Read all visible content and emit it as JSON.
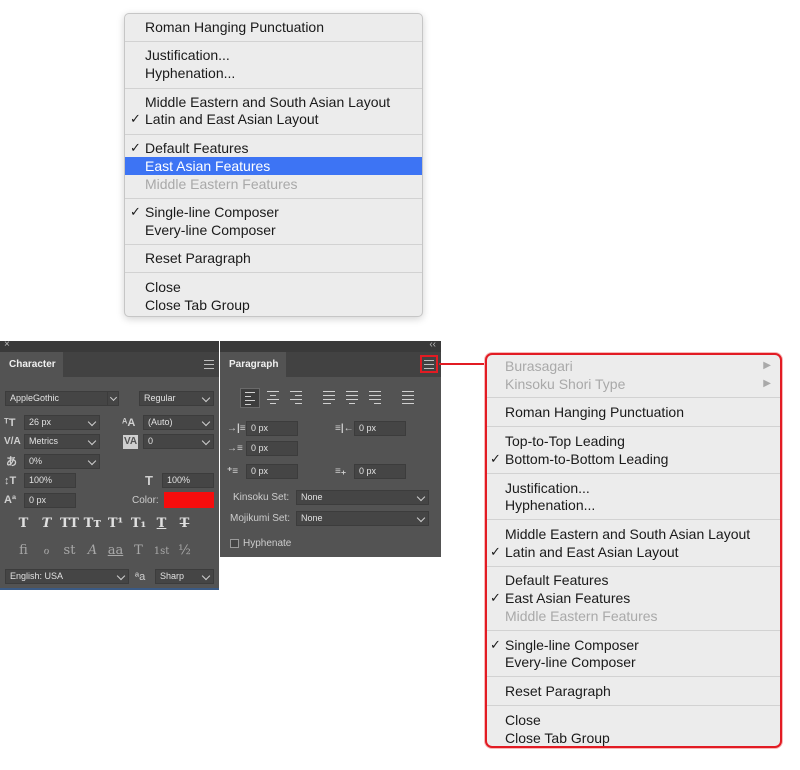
{
  "top_menu": {
    "groups": [
      [
        {
          "label": "Roman Hanging Punctuation"
        }
      ],
      [
        {
          "label": "Justification..."
        },
        {
          "label": "Hyphenation..."
        }
      ],
      [
        {
          "label": "Middle Eastern and South Asian Layout"
        },
        {
          "label": "Latin and East Asian Layout",
          "checked": true
        }
      ],
      [
        {
          "label": "Default Features",
          "checked": true
        },
        {
          "label": "East Asian Features",
          "highlighted": true
        },
        {
          "label": "Middle Eastern Features",
          "disabled": true
        }
      ],
      [
        {
          "label": "Single-line Composer",
          "checked": true
        },
        {
          "label": "Every-line Composer"
        }
      ],
      [
        {
          "label": "Reset Paragraph"
        }
      ],
      [
        {
          "label": "Close"
        },
        {
          "label": "Close Tab Group"
        }
      ]
    ]
  },
  "right_menu": {
    "groups": [
      [
        {
          "label": "Burasagari",
          "disabled": true,
          "submenu": true
        },
        {
          "label": "Kinsoku Shori Type",
          "disabled": true,
          "submenu": true
        }
      ],
      [
        {
          "label": "Roman Hanging Punctuation"
        }
      ],
      [
        {
          "label": "Top-to-Top Leading"
        },
        {
          "label": "Bottom-to-Bottom Leading",
          "checked": true
        }
      ],
      [
        {
          "label": "Justification..."
        },
        {
          "label": "Hyphenation..."
        }
      ],
      [
        {
          "label": "Middle Eastern and South Asian Layout"
        },
        {
          "label": "Latin and East Asian Layout",
          "checked": true
        }
      ],
      [
        {
          "label": "Default Features"
        },
        {
          "label": "East Asian Features",
          "checked": true
        },
        {
          "label": "Middle Eastern Features",
          "disabled": true
        }
      ],
      [
        {
          "label": "Single-line Composer",
          "checked": true
        },
        {
          "label": "Every-line Composer"
        }
      ],
      [
        {
          "label": "Reset Paragraph"
        }
      ],
      [
        {
          "label": "Close"
        },
        {
          "label": "Close Tab Group"
        }
      ]
    ]
  },
  "character_panel": {
    "tab_label": "Character",
    "font_family": "AppleGothic",
    "font_style": "Regular",
    "font_size": "26 px",
    "leading": "(Auto)",
    "kerning": "Metrics",
    "tracking": "0",
    "tsume": "0%",
    "vertical_scale": "100%",
    "horizontal_scale": "100%",
    "baseline_shift": "0 px",
    "color_label": "Color:",
    "color_value": "#f50d0d",
    "language": "English: USA",
    "aa_label": "a",
    "antialias": "Sharp",
    "style_glyphs": [
      "T",
      "T",
      "TT",
      "Tт",
      "T¹",
      "T₁",
      "T",
      "T"
    ],
    "opentype_glyphs": [
      "fi",
      "ℴ",
      "st",
      "A",
      "aa",
      "T",
      "1st",
      "½"
    ]
  },
  "paragraph_panel": {
    "tab_label": "Paragraph",
    "indent_left": "0 px",
    "indent_right": "0 px",
    "indent_first": "0 px",
    "space_before": "0 px",
    "space_after": "0 px",
    "kinsoku_label": "Kinsoku Set:",
    "kinsoku_value": "None",
    "mojikumi_label": "Mojikumi Set:",
    "mojikumi_value": "None",
    "hyphenate_label": "Hyphenate"
  },
  "colors": {
    "highlight": "#3d74f4",
    "annotation_red": "#e21b23"
  }
}
